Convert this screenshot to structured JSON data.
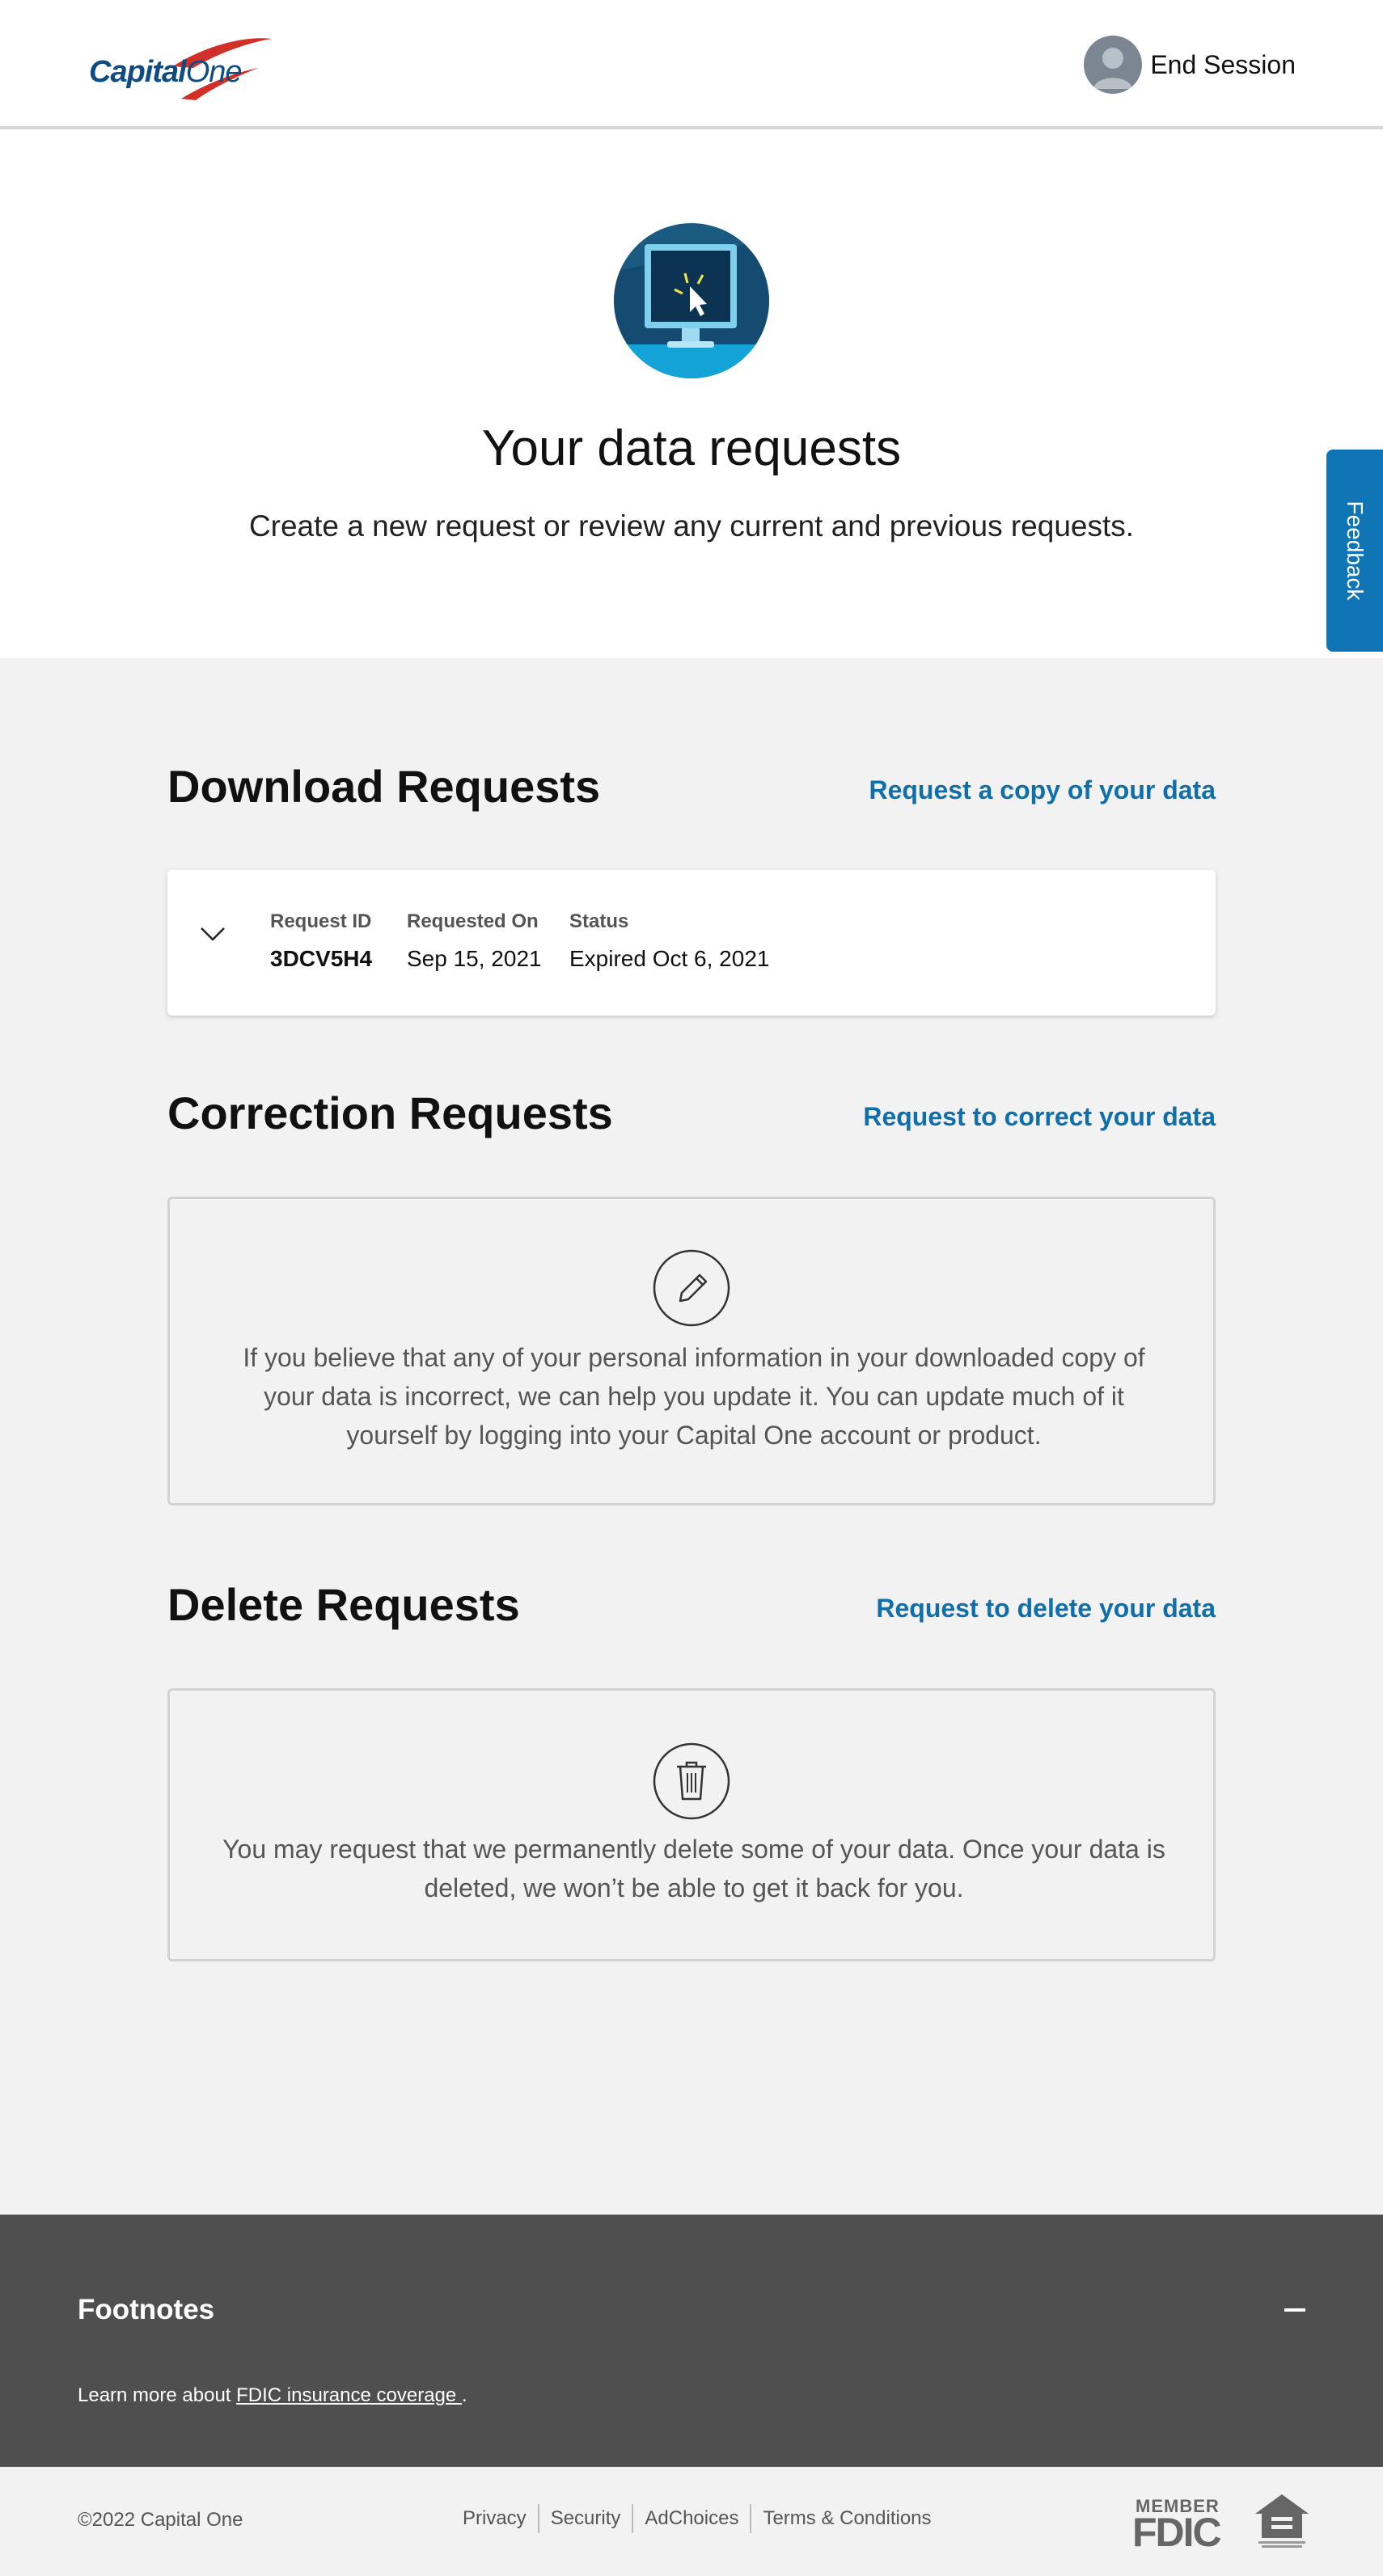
{
  "header": {
    "logo_text_capital": "Capital",
    "logo_text_one": "One",
    "end_session_label": "End Session"
  },
  "hero": {
    "title": "Your data requests",
    "subtitle": "Create a new request or review any current and previous requests."
  },
  "feedback_label": "Feedback",
  "download": {
    "title": "Download Requests",
    "link": "Request a copy of your data",
    "columns": [
      {
        "label": "Request ID",
        "value": "3DCV5H4"
      },
      {
        "label": "Requested On",
        "value": "Sep 15, 2021"
      },
      {
        "label": "Status",
        "value": "Expired Oct 6, 2021"
      }
    ]
  },
  "correction": {
    "title": "Correction Requests",
    "link": "Request to correct your data",
    "icon": "pencil-icon",
    "text": "If you believe that any of your personal information in your downloaded copy of your data is incorrect, we can help you update it. You can update much of it yourself by logging into your Capital One account or product."
  },
  "delete": {
    "title": "Delete Requests",
    "link": "Request to delete your data",
    "icon": "trash-icon",
    "text": "You may request that we permanently delete some of your data. Once your data is deleted, we won’t be able to get it back for you."
  },
  "footnotes": {
    "title": "Footnotes",
    "text_prefix": "Learn more about ",
    "link_text": "FDIC insurance coverage ",
    "text_suffix": "."
  },
  "footer": {
    "copyright": "©2022 Capital One",
    "links": [
      "Privacy",
      "Security",
      "AdChoices",
      "Terms & Conditions"
    ],
    "fdic_member": "MEMBER",
    "fdic": "FDIC"
  },
  "colors": {
    "brand_blue": "#0f4c81",
    "link_blue": "#0f6fab",
    "feedback_blue": "#0f75b5",
    "logo_red": "#d03027",
    "footnotes_bg": "#4f4f4f"
  }
}
